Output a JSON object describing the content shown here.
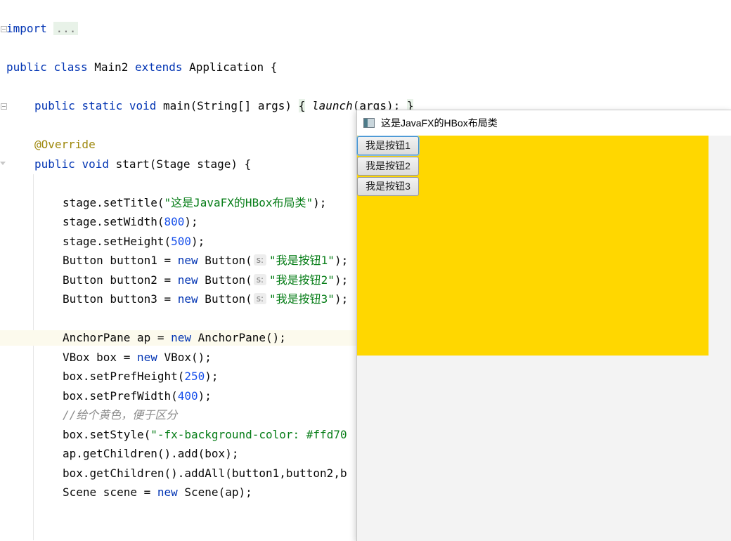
{
  "editor": {
    "import_kw": "import",
    "import_fold": "...",
    "class_decl": {
      "kw1": "public",
      "kw2": "class",
      "name": " Main2 ",
      "kw3": "extends",
      "rest": " Application {"
    },
    "main_decl": {
      "kw1": "public",
      "kw2": "static",
      "kw3": "void",
      "name": " main(String[] args) ",
      "lbrace": "{",
      "launch": "launch",
      "args": "(args); ",
      "rbrace": "}"
    },
    "override": "@Override",
    "start_decl": {
      "kw1": "public",
      "kw2": "void",
      "rest": " start(Stage stage) {"
    },
    "set_title": {
      "pre": "stage.setTitle(",
      "str": "\"这是JavaFX的HBox布局类\"",
      "post": ");"
    },
    "set_width": {
      "pre": "stage.setWidth(",
      "num": "800",
      "post": ");"
    },
    "set_height": {
      "pre": "stage.setHeight(",
      "num": "500",
      "post": ");"
    },
    "buttons_code": [
      {
        "pre": "Button button1 = ",
        "kw": "new",
        "mid": " Button(",
        "hint": "s:",
        "str": "\"我是按钮1\"",
        "post": ");"
      },
      {
        "pre": "Button button2 = ",
        "kw": "new",
        "mid": " Button(",
        "hint": "s:",
        "str": "\"我是按钮2\"",
        "post": ");"
      },
      {
        "pre": "Button button3 = ",
        "kw": "new",
        "mid": " Button(",
        "hint": "s:",
        "str": "\"我是按钮3\"",
        "post": ");"
      }
    ],
    "anchor_pane": {
      "pre": "AnchorPane ap = ",
      "kw": "new",
      "post": " AnchorPane();"
    },
    "vbox": {
      "pre": "VBox box = ",
      "kw": "new",
      "post": " VBox();"
    },
    "pref_height": {
      "pre": "box.setPrefHeight(",
      "num": "250",
      "post": ");"
    },
    "pref_width": {
      "pre": "box.setPrefWidth(",
      "num": "400",
      "post": ");"
    },
    "comment": "//给个黄色，便于区分",
    "set_style": {
      "pre": "box.setStyle(",
      "str": "\"-fx-background-color: #ffd70"
    },
    "add_box": "ap.getChildren().add(box);",
    "add_all": "box.getChildren().addAll(button1,button2,b",
    "scene": {
      "pre": "Scene scene = ",
      "kw": "new",
      "post": " Scene(ap);"
    }
  },
  "fx_window": {
    "title": "这是JavaFX的HBox布局类",
    "icon": "javafx-app-icon",
    "vbox_color": "#ffd700",
    "buttons": [
      "我是按钮1",
      "我是按钮2",
      "我是按钮3"
    ]
  }
}
